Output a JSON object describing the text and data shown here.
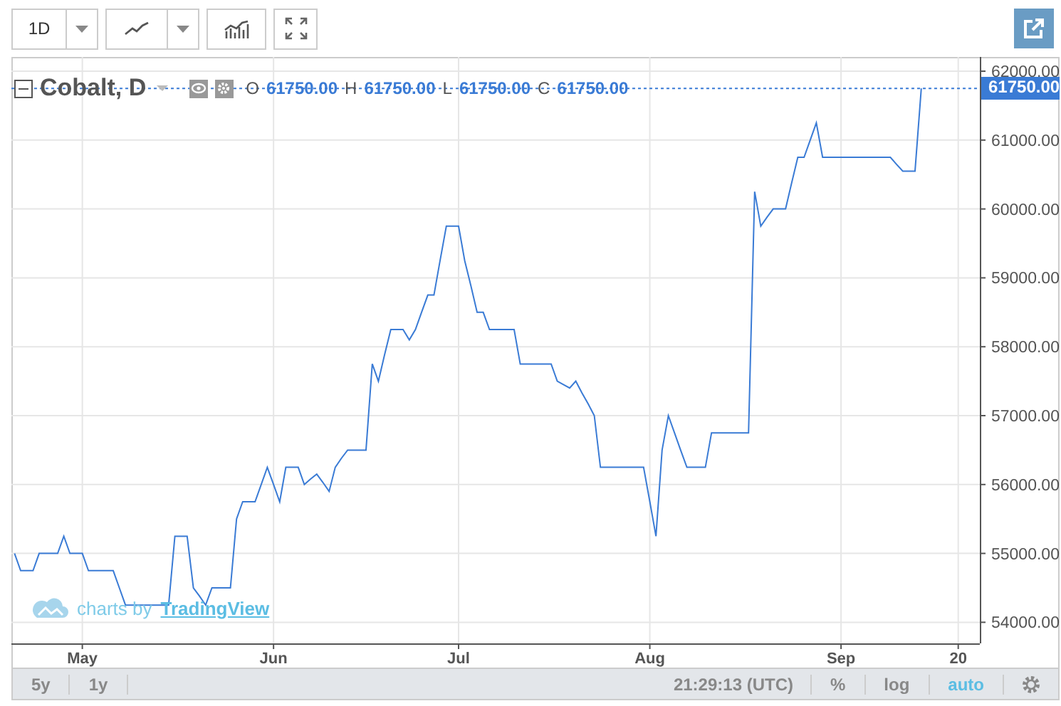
{
  "toolbar": {
    "interval": "1D"
  },
  "legend": {
    "fields": [
      {
        "label": "O",
        "value": "61750.00"
      },
      {
        "label": "H",
        "value": "61750.00"
      },
      {
        "label": "L",
        "value": "61750.00"
      },
      {
        "label": "C",
        "value": "61750.00"
      }
    ]
  },
  "chart": {
    "last_price": "61750.00",
    "chart_data": {
      "type": "line",
      "categories": [
        null,
        null,
        null,
        null,
        null,
        null,
        null,
        null,
        null,
        null,
        null,
        "May",
        null,
        null,
        null,
        null,
        null,
        null,
        null,
        null,
        null,
        null,
        null,
        null,
        null,
        null,
        null,
        null,
        null,
        null,
        null,
        null,
        null,
        null,
        null,
        null,
        null,
        null,
        null,
        null,
        null,
        null,
        "Jun",
        null,
        null,
        null,
        null,
        null,
        null,
        null,
        null,
        null,
        null,
        null,
        null,
        null,
        null,
        null,
        null,
        null,
        null,
        null,
        null,
        null,
        null,
        null,
        null,
        null,
        null,
        null,
        null,
        null,
        "Jul",
        null,
        null,
        null,
        null,
        null,
        null,
        null,
        null,
        null,
        null,
        null,
        null,
        null,
        null,
        null,
        null,
        null,
        null,
        null,
        null,
        null,
        null,
        null,
        null,
        null,
        null,
        null,
        null,
        null,
        null,
        "Aug",
        null,
        null,
        null,
        null,
        null,
        null,
        null,
        null,
        null,
        null,
        null,
        null,
        null,
        null,
        null,
        null,
        null,
        null,
        null,
        null,
        null,
        null,
        null,
        null,
        null,
        null,
        null,
        null,
        null,
        null,
        "Sep",
        null,
        null,
        null,
        null,
        null,
        null,
        null,
        null,
        null,
        null,
        null,
        null,
        null,
        null,
        null,
        null,
        null,
        null,
        "20",
        null,
        null,
        null
      ],
      "series": [
        {
          "name": "Cobalt, D",
          "color": "#3a7bd5",
          "values": [
            55000,
            54750,
            54750,
            54750,
            55000,
            55000,
            55000,
            55000,
            55250,
            55000,
            55000,
            55000,
            54750,
            54750,
            54750,
            54750,
            54750,
            54500,
            54250,
            54250,
            54250,
            54250,
            54250,
            54250,
            54250,
            54250,
            55250,
            55250,
            55250,
            54500,
            54380,
            54250,
            54500,
            54500,
            54500,
            54500,
            55500,
            55750,
            55750,
            55750,
            56000,
            56250,
            56000,
            55750,
            56250,
            56250,
            56250,
            56000,
            56080,
            56150,
            56030,
            55900,
            56250,
            56380,
            56500,
            56500,
            56500,
            56500,
            57750,
            57500,
            57880,
            58250,
            58250,
            58250,
            58100,
            58250,
            58500,
            58750,
            58750,
            59250,
            59750,
            59750,
            59750,
            59250,
            58880,
            58500,
            58500,
            58250,
            58250,
            58250,
            58250,
            58250,
            57750,
            57750,
            57750,
            57750,
            57750,
            57750,
            57500,
            57450,
            57400,
            57500,
            57330,
            57170,
            57000,
            56250,
            56250,
            56250,
            56250,
            56250,
            56250,
            56250,
            56250,
            55750,
            55250,
            56500,
            57000,
            56750,
            56500,
            56250,
            56250,
            56250,
            56250,
            56750,
            56750,
            56750,
            56750,
            56750,
            56750,
            56750,
            60250,
            59750,
            59880,
            60000,
            60000,
            60000,
            60380,
            60750,
            60750,
            61000,
            61250,
            60750,
            60750,
            60750,
            60750,
            60750,
            60750,
            60750,
            60750,
            60750,
            60750,
            60750,
            60750,
            60650,
            60550,
            60550,
            60550,
            61750,
            null,
            null,
            null,
            null,
            null,
            null,
            null,
            null,
            null
          ]
        }
      ],
      "ylim": [
        53694,
        62207
      ],
      "grid": true,
      "ref_lines": [
        {
          "axis": "y",
          "value": 61750
        }
      ],
      "yticks": [
        {
          "value": 54000,
          "label": "54000.00"
        },
        {
          "value": 55000,
          "label": "55000.00"
        },
        {
          "value": 56000,
          "label": "56000.00"
        },
        {
          "value": 57000,
          "label": "57000.00"
        },
        {
          "value": 58000,
          "label": "58000.00"
        },
        {
          "value": 59000,
          "label": "59000.00"
        },
        {
          "value": 60000,
          "label": "60000.00"
        },
        {
          "value": 61000,
          "label": "61000.00"
        },
        {
          "value": 62000,
          "label": "62000.00"
        }
      ]
    },
    "branding": {
      "text": "charts by",
      "link": "TradingView"
    }
  },
  "bottom_bar": {
    "ranges": [
      {
        "label": "5y"
      },
      {
        "label": "1y"
      }
    ],
    "time": "21:29:13 (UTC)",
    "options": [
      {
        "label": "%",
        "selected": false
      },
      {
        "label": "log",
        "selected": false
      },
      {
        "label": "auto",
        "selected": true
      }
    ]
  }
}
